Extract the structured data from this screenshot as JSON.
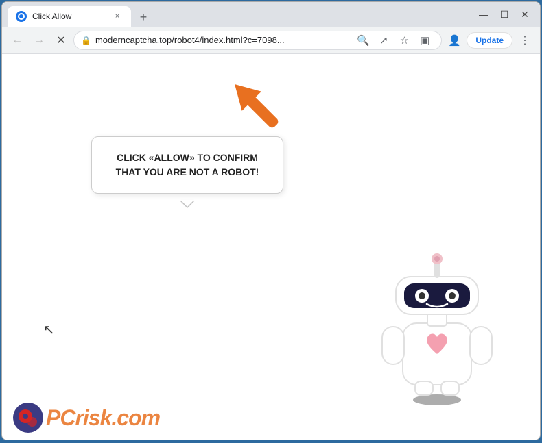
{
  "browser": {
    "title": "Click Allow",
    "tab_close_label": "×",
    "tab_new_label": "+",
    "url": "moderncaptcha.top/robot4/index.html?c=7098...",
    "update_button_label": "Update",
    "window_controls": {
      "minimize": "—",
      "maximize": "☐",
      "close": "✕"
    },
    "nav": {
      "back": "←",
      "forward": "→",
      "reload": "✕"
    }
  },
  "page": {
    "bubble_text": "CLICK «ALLOW» TO CONFIRM THAT YOU ARE NOT A ROBOT!",
    "arrow_direction": "up-left"
  },
  "watermark": {
    "pc_text": "PC",
    "risk_text": "risk.com"
  }
}
